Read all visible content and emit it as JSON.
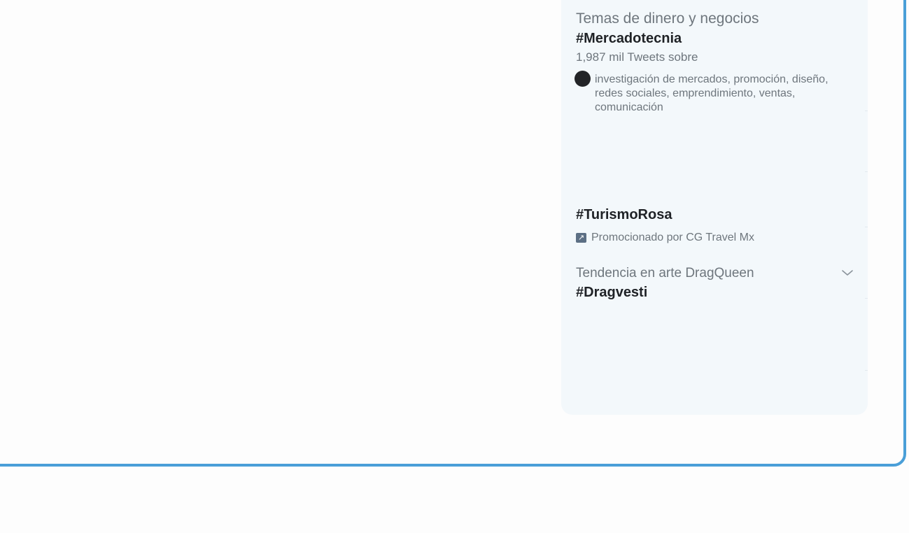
{
  "trends": [
    {
      "category": "Temas de dinero y negocios",
      "name": "#Mercadotecnia",
      "tweet_count": "1,987 mil Tweets sobre",
      "topics": "investigación de mercados, promoción, diseño, redes sociales, emprendimiento, ventas, comunicación"
    },
    {
      "name": "#TurismoRosa",
      "promoted_by": "Promocionado por CG Travel Mx",
      "promoted_icon": "promoted-arrow-icon"
    },
    {
      "context": "Tendencia en arte DragQueen",
      "name": "#Dragvesti",
      "menu_icon": "chevron-down-icon"
    }
  ],
  "colors": {
    "frame_border": "#4a9fd8",
    "panel_background": "#f3f8fb",
    "muted_text": "#6e767d",
    "primary_text": "#1f2226"
  }
}
